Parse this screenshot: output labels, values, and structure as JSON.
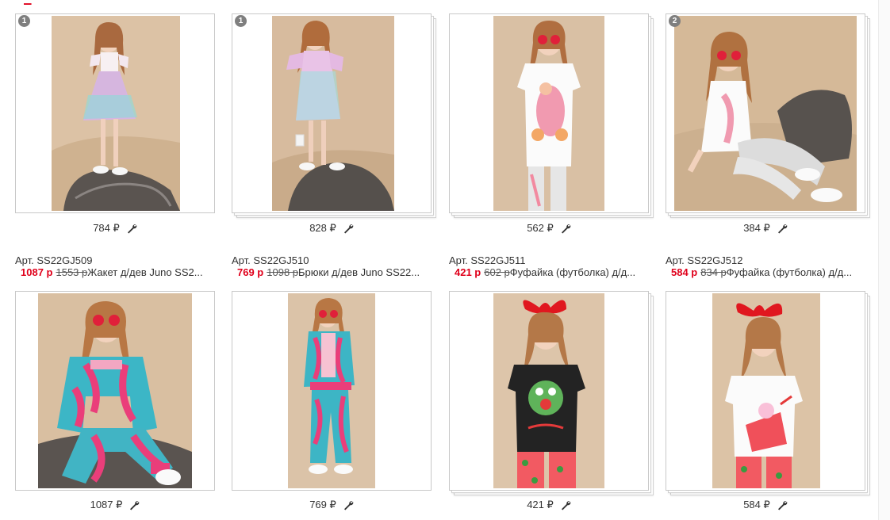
{
  "top_row": [
    {
      "badge": "1",
      "price_text": "784 ₽",
      "photo": "dress",
      "bg": "#dcc2a5"
    },
    {
      "badge": "1",
      "price_text": "828 ₽",
      "photo": "mermaid",
      "bg": "#d7bb9e"
    },
    {
      "badge": "",
      "price_text": "562 ₽",
      "photo": "tee_flamingo",
      "bg": "#d9c0a4"
    },
    {
      "badge": "2",
      "price_text": "384 ₽",
      "photo": "sitting",
      "bg": "#d5b998"
    }
  ],
  "bottom_row": [
    {
      "article": "Арт. SS22GJ509",
      "price_new": "1087 р",
      "price_old": "1553 р",
      "name": "Жакет д/дев Juno SS2...",
      "price_text": "1087 ₽",
      "photo": "jacket",
      "bg": "#d9bfa1"
    },
    {
      "article": "Арт. SS22GJ510",
      "price_new": "769 р",
      "price_old": "1098 р",
      "name": "Брюки д/дев Juno SS22...",
      "price_text": "769 ₽",
      "photo": "pants",
      "bg": "#dbc3a8"
    },
    {
      "article": "Арт. SS22GJ511",
      "price_new": "421 р",
      "price_old": "602 р",
      "name": "Фуфайка (футболка) д/д...",
      "price_text": "421 ₽",
      "photo": "black_tee",
      "bg": "#ddc5aa"
    },
    {
      "article": "Арт. SS22GJ512",
      "price_new": "584 р",
      "price_old": "834 р",
      "name": "Фуфайка (футболка) д/д...",
      "price_text": "584 ₽",
      "photo": "watermelon_tee",
      "bg": "#dcc3a6"
    }
  ],
  "colors": {
    "accent_red": "#e0001b",
    "border": "#c8c8c8",
    "badge_gray": "#7f7f7f"
  },
  "icons": {
    "edit": "wrench-icon"
  }
}
